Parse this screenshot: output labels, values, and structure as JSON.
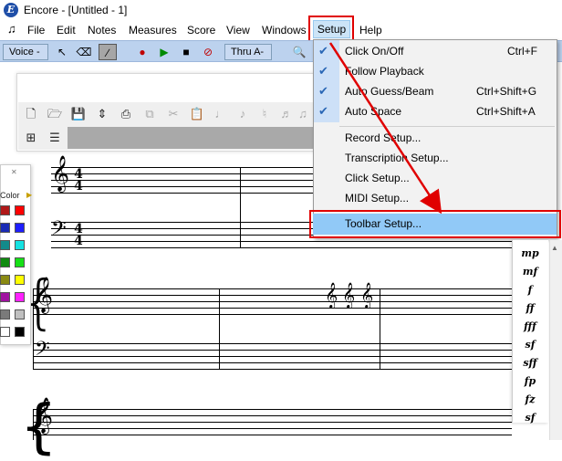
{
  "window": {
    "title": "Encore - [Untitled - 1]",
    "logo_letter": "E"
  },
  "menubar": {
    "items": [
      "File",
      "Edit",
      "Notes",
      "Measures",
      "Score",
      "View",
      "Windows",
      "Setup",
      "Help"
    ]
  },
  "toolbar": {
    "voice_label": "Voice -",
    "thru_label": "Thru A-"
  },
  "color_window": {
    "close_glyph": "✕",
    "label": "Color",
    "swatches": [
      "#b01818",
      "#ff0000",
      "#1a2bb5",
      "#1e1eff",
      "#128a8a",
      "#16e2e2",
      "#0f8a0f",
      "#16e016",
      "#8a8a12",
      "#ffff00",
      "#a012a0",
      "#ff20ff",
      "#7a7a7a",
      "#c0c0c0",
      "#ffffff",
      "#000000"
    ]
  },
  "setup_menu": {
    "items": [
      {
        "label": "Click On/Off",
        "shortcut": "Ctrl+F",
        "checked": true
      },
      {
        "label": "Follow Playback",
        "shortcut": "",
        "checked": true
      },
      {
        "label": "Auto Guess/Beam",
        "shortcut": "Ctrl+Shift+G",
        "checked": true
      },
      {
        "label": "Auto Space",
        "shortcut": "Ctrl+Shift+A",
        "checked": true
      },
      {
        "label": "Record Setup...",
        "shortcut": "",
        "checked": false
      },
      {
        "label": "Transcription Setup...",
        "shortcut": "",
        "checked": false
      },
      {
        "label": "Click Setup...",
        "shortcut": "",
        "checked": false
      },
      {
        "label": "MIDI Setup...",
        "shortcut": "",
        "checked": false
      },
      {
        "label": "Toolbar Setup...",
        "shortcut": "",
        "checked": false,
        "highlighted": true
      }
    ]
  },
  "dynamics": [
    "mp",
    "mf",
    "f",
    "ff",
    "fff",
    "sf",
    "sff",
    "fp",
    "fz",
    "sf"
  ],
  "score": {
    "time_signature_top": "4",
    "time_signature_bottom": "4"
  },
  "colors": {
    "highlight_red": "#e00000",
    "toolbar_blue": "#bcd2ee",
    "menu_hover": "#91c9f7"
  }
}
